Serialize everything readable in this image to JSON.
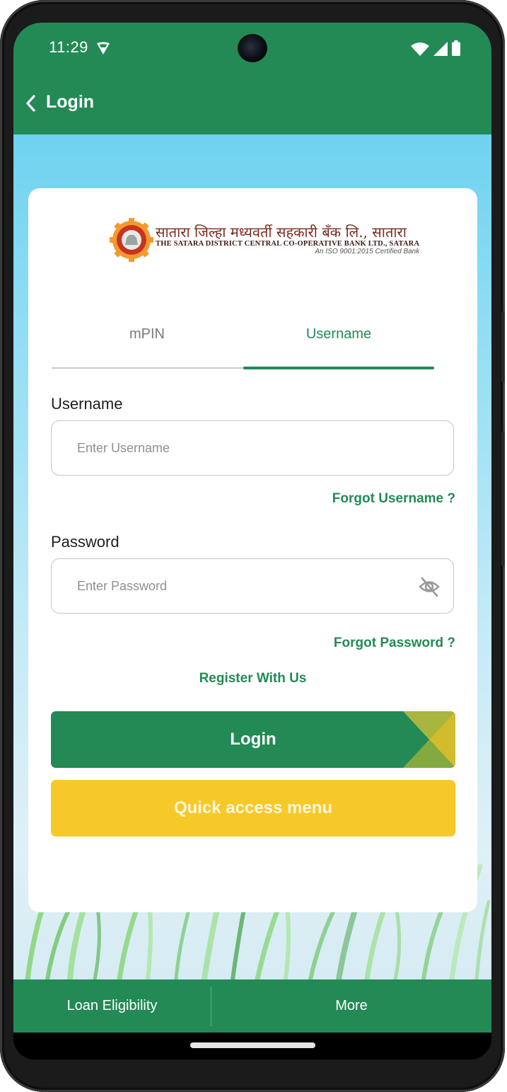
{
  "status_bar": {
    "time": "11:29",
    "icons": [
      "vpn-shield-icon",
      "wifi-icon",
      "signal-icon",
      "battery-icon"
    ]
  },
  "app_bar": {
    "back_icon": "chevron-left-icon",
    "title": "Login"
  },
  "logo": {
    "marathi_name": "सातारा जिल्हा मध्यवर्ती सहकारी बँक लि., सातारा",
    "english_name": "THE SATARA DISTRICT CENTRAL CO-OPERATIVE BANK LTD., SATARA",
    "certification": "An ISO 9001:2015 Certified Bank"
  },
  "tabs": {
    "items": [
      {
        "label": "mPIN",
        "active": false
      },
      {
        "label": "Username",
        "active": true
      }
    ]
  },
  "form": {
    "username": {
      "label": "Username",
      "placeholder": "Enter Username",
      "value": ""
    },
    "forgot_username": "Forgot Username ?",
    "password": {
      "label": "Password",
      "placeholder": "Enter Password",
      "value": "",
      "toggle_icon": "eye-off-icon"
    },
    "forgot_password": "Forgot Password ?",
    "register": "Register With Us",
    "login_button": "Login",
    "quick_access_button": "Quick access menu"
  },
  "bottom_nav": {
    "items": [
      {
        "label": "Loan Eligibility"
      },
      {
        "label": "More"
      }
    ]
  },
  "colors": {
    "primary_green": "#238a56",
    "accent_yellow": "#f7c928",
    "inactive_tab": "#7a7a7a"
  }
}
